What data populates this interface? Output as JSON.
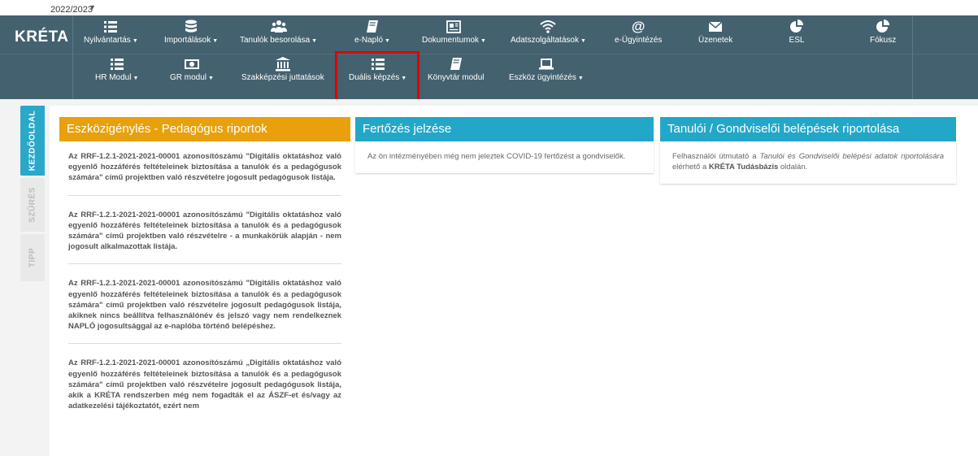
{
  "school_year": "2022/2023",
  "logo": "KRÉTA",
  "nav_row1": [
    {
      "label": "Nyilvántartás",
      "dropdown": true,
      "icon": "list-icon"
    },
    {
      "label": "Importálások",
      "dropdown": true,
      "icon": "database-icon"
    },
    {
      "label": "Tanulók besorolása",
      "dropdown": true,
      "icon": "users-icon"
    },
    {
      "label": "e-Napló",
      "dropdown": true,
      "icon": "book-icon"
    },
    {
      "label": "Dokumentumok",
      "dropdown": true,
      "icon": "document-icon"
    },
    {
      "label": "Adatszolgáltatások",
      "dropdown": true,
      "icon": "wifi-icon"
    },
    {
      "label": "e-Ügyintézés",
      "dropdown": false,
      "icon": "at-icon"
    },
    {
      "label": "Üzenetek",
      "dropdown": false,
      "icon": "envelope-icon"
    },
    {
      "label": "ESL",
      "dropdown": false,
      "icon": "pie-chart-icon"
    },
    {
      "label": "Fókusz",
      "dropdown": false,
      "icon": "pie-chart-icon"
    }
  ],
  "nav_row2": [
    {
      "label": "HR Modul",
      "dropdown": true,
      "icon": "list-icon"
    },
    {
      "label": "GR modul",
      "dropdown": true,
      "icon": "money-icon"
    },
    {
      "label": "Szakképzési juttatások",
      "dropdown": false,
      "icon": "bank-icon"
    },
    {
      "label": "Duális képzés",
      "dropdown": true,
      "icon": "list-icon"
    },
    {
      "label": "Könyvtár modul",
      "dropdown": false,
      "icon": "book-icon"
    },
    {
      "label": "Eszköz ügyintézés",
      "dropdown": true,
      "icon": "laptop-icon"
    }
  ],
  "side_tabs": [
    "KEZDŐOLDAL",
    "SZŰRÉS",
    "TIPP"
  ],
  "panels": {
    "eszkoz": {
      "title": "Eszközigénylés - Pedagógus riportok",
      "items": [
        "Az RRF-1.2.1-2021-2021-00001 azonosítószámú \"Digitális oktatáshoz való egyenlő hozzáférés feltételeinek biztosítása a tanulók és a pedagógusok számára\" című projektben való részvételre jogosult pedagógusok listája.",
        "Az RRF-1.2.1-2021-2021-00001 azonosítószámú \"Digitális oktatáshoz való egyenlő hozzáférés feltételeinek biztosítása a tanulók és a pedagógusok számára\" című projektben való részvételre - a munkakörük alapján - nem jogosult alkalmazottak listája.",
        "Az RRF-1.2.1-2021-2021-00001 azonosítószámú \"Digitális oktatáshoz való egyenlő hozzáférés feltételeinek biztosítása a tanulók és a pedagógusok számára\" című projektben való részvételre jogosult pedagógusok listája, akiknek nincs beállítva felhasználónév és jelszó vagy nem rendelkeznek NAPLÓ jogosultsággal az e-naplóba történő belépéshez.",
        "Az RRF-1.2.1-2021-2021-00001 azonosítószámú „Digitális oktatáshoz való egyenlő hozzáférés feltételeinek biztosítása a tanulók és a pedagógusok számára\" című projektben való részvételre jogosult pedagógusok listája, akik a KRÉTA rendszerben még nem fogadták el az ÁSZF-et és/vagy az adatkezelési tájékoztatót, ezért nem"
      ]
    },
    "fertozes": {
      "title": "Fertőzés jelzése",
      "text": "Az ön intézményében még nem jeleztek COVID-19 fertőzést a gondviselők."
    },
    "belepesek": {
      "title": "Tanulói / Gondviselői belépések riportolása",
      "text_pre": "Felhasználói útmutató a ",
      "text_italic": "Tanulói és Gondviselői belépési adatok riportolására",
      "text_mid": " elérhető a ",
      "text_bold": "KRÉTA Tudásbázis",
      "text_post": " oldalán."
    }
  }
}
